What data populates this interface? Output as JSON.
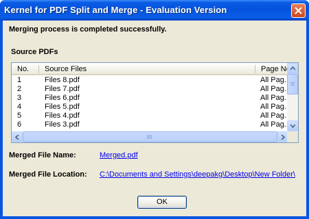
{
  "window": {
    "title": "Kernel for PDF Split and Merge - Evaluation Version"
  },
  "status_message": "Merging process is completed successfully.",
  "source_section_label": "Source PDFs",
  "table": {
    "columns": [
      "No.",
      "Source Files",
      "Page No"
    ],
    "rows": [
      [
        "1",
        "Files 8.pdf",
        "All Pag..."
      ],
      [
        "2",
        "Files 7.pdf",
        "All Pag..."
      ],
      [
        "3",
        "Files 6.pdf",
        "All Pag..."
      ],
      [
        "4",
        "Files 5.pdf",
        "All Pag..."
      ],
      [
        "5",
        "Files 4.pdf",
        "All Pag..."
      ],
      [
        "6",
        "Files 3.pdf",
        "All Pag..."
      ]
    ]
  },
  "merged_file": {
    "name_label": "Merged File Name:",
    "name_value": "Merged.pdf",
    "location_label": "Merged File Location:",
    "location_value": "C:\\Documents and Settings\\deepakg\\Desktop\\New Folder\\"
  },
  "buttons": {
    "ok_label": "OK"
  },
  "colors": {
    "titlebar": "#0653dc",
    "dialog_bg": "#ece9d8",
    "link": "#0000ee",
    "close_button": "#cc4622"
  }
}
